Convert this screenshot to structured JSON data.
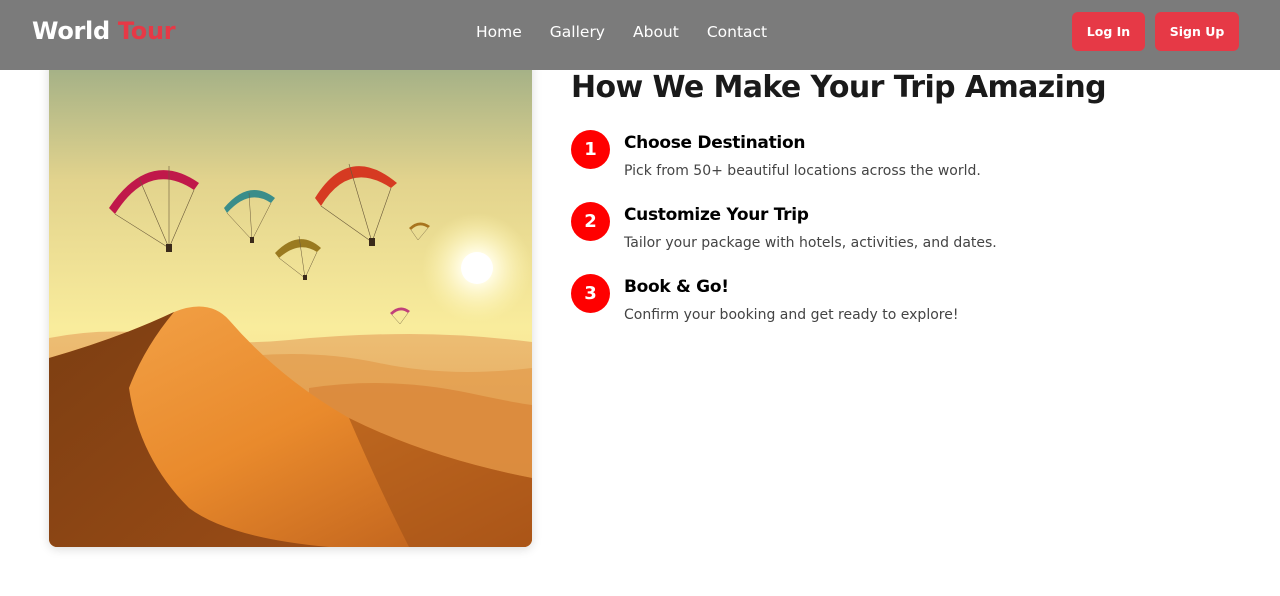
{
  "brand": {
    "name_main": "World",
    "name_accent": "Tour"
  },
  "nav": {
    "links": [
      {
        "label": "Home"
      },
      {
        "label": "Gallery"
      },
      {
        "label": "About"
      },
      {
        "label": "Contact"
      }
    ],
    "login_label": "Log In",
    "signup_label": "Sign Up"
  },
  "colors": {
    "navbar": "#7b7b7b",
    "accent": "#e63946",
    "step_badge": "#ff0000"
  },
  "photo": {
    "subject": "paragliders over desert dunes at sunset"
  },
  "section": {
    "heading": "How We Make Your Trip Amazing",
    "steps": [
      {
        "number": "1",
        "title": "Choose Destination",
        "description": "Pick from 50+ beautiful locations across the world."
      },
      {
        "number": "2",
        "title": "Customize Your Trip",
        "description": "Tailor your package with hotels, activities, and dates."
      },
      {
        "number": "3",
        "title": "Book & Go!",
        "description": "Confirm your booking and get ready to explore!"
      }
    ]
  }
}
